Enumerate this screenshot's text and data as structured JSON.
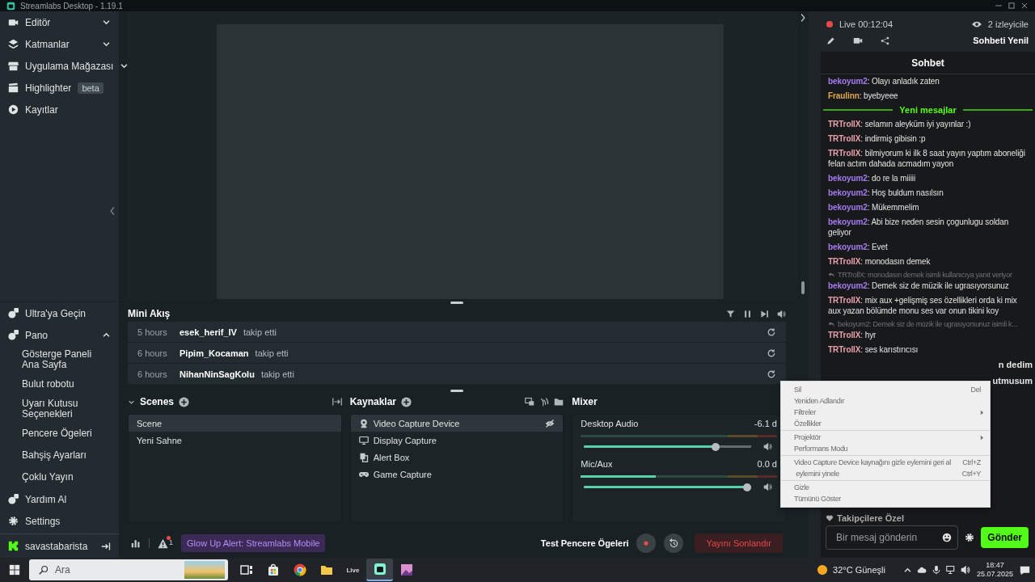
{
  "window": {
    "title": "Streamlabs Desktop - 1.19.1"
  },
  "sidebar": {
    "items": [
      {
        "label": "Editör",
        "expanded": false
      },
      {
        "label": "Katmanlar",
        "expanded": false
      },
      {
        "label": "Uygulama Mağazası",
        "expanded": false
      },
      {
        "label": "Highlighter",
        "badge": "beta"
      },
      {
        "label": "Kayıtlar"
      }
    ],
    "bottom_items": [
      {
        "label": "Ultra'ya Geçin"
      },
      {
        "label": "Pano",
        "expanded": true,
        "children": [
          {
            "label": "Gösterge Paneli Ana Sayfa"
          },
          {
            "label": "Bulut robotu"
          },
          {
            "label": "Uyarı Kutusu Seçenekleri"
          },
          {
            "label": "Pencere Ögeleri"
          },
          {
            "label": "Bahşiş Ayarları"
          },
          {
            "label": "Çoklu Yayın"
          }
        ]
      },
      {
        "label": "Yardım Al"
      },
      {
        "label": "Settings"
      }
    ],
    "user": {
      "name": "savastabarista"
    }
  },
  "mini_feed": {
    "title": "Mini Akış",
    "events": [
      {
        "time": "5 hours",
        "user": "esek_herif_IV",
        "action": "takip etti"
      },
      {
        "time": "6 hours",
        "user": "Pipim_Kocaman",
        "action": "takip etti"
      },
      {
        "time": "6 hours",
        "user": "NihanNinSagKolu",
        "action": "takip etti"
      }
    ]
  },
  "scenes": {
    "title": "Scenes",
    "items": [
      {
        "label": "Scene",
        "selected": true
      },
      {
        "label": "Yeni Sahne",
        "selected": false
      }
    ]
  },
  "sources": {
    "title": "Kaynaklar",
    "items": [
      {
        "label": "Video Capture Device",
        "kind": "webcam",
        "selected": true,
        "hidden": true
      },
      {
        "label": "Display Capture",
        "kind": "display",
        "selected": false,
        "hidden": false
      },
      {
        "label": "Alert Box",
        "kind": "alert",
        "selected": false,
        "hidden": false
      },
      {
        "label": "Game Capture",
        "kind": "game",
        "selected": false,
        "hidden": false
      }
    ]
  },
  "mixer": {
    "title": "Mixer",
    "channels": [
      {
        "name": "Desktop Audio",
        "reading": "-6.1 d",
        "level": 0.8
      },
      {
        "name": "Mic/Aux",
        "reading": "0.0 d",
        "level": 1.0,
        "meter": {
          "level": 0.38
        }
      }
    ]
  },
  "bottom_bar": {
    "alert_count": "1",
    "notification": "Glow Up Alert: Streamlabs Mobile",
    "test_label": "Test Pencere Ögeleri",
    "end_stream": "Yayını Sonlandır"
  },
  "chat": {
    "status": "Live 00:12:04",
    "viewers": "2 izleyicile",
    "refresh": "Sohbeti Yenil",
    "title": "Sohbet",
    "messages": [
      {
        "kind": "message",
        "user": "bekoyum2",
        "color": "#a47cf0",
        "text": ": Olayı anladık zaten"
      },
      {
        "kind": "message",
        "user": "Fraulinn",
        "color": "#e0a84e",
        "text": ": byebyeee"
      },
      {
        "kind": "divider",
        "text": "Yeni mesajlar"
      },
      {
        "kind": "message",
        "user": "TRTrollX",
        "color": "#e8a0ab",
        "text": ": selamın aleyküm iyi yayınlar :)"
      },
      {
        "kind": "message",
        "user": "TRTrollX",
        "color": "#e8a0ab",
        "text": ": indirmiş gibisin :p"
      },
      {
        "kind": "message",
        "user": "TRTrollX",
        "color": "#e8a0ab",
        "text": ": bilmiyorum ki ilk 8 saat yayın yaptım aboneliği felan actım dahada acmadım yayon"
      },
      {
        "kind": "message",
        "user": "bekoyum2",
        "color": "#a47cf0",
        "text": ": do re la miiiii"
      },
      {
        "kind": "message",
        "user": "bekoyum2",
        "color": "#a47cf0",
        "text": ": Hoş buldum nasılsın"
      },
      {
        "kind": "message",
        "user": "bekoyum2",
        "color": "#a47cf0",
        "text": ": Mükemmelim"
      },
      {
        "kind": "message",
        "user": "bekoyum2",
        "color": "#a47cf0",
        "text": ": Abi bize neden sesin çogunlugu soldan geliyor"
      },
      {
        "kind": "message",
        "user": "bekoyum2",
        "color": "#a47cf0",
        "text": ": Evet"
      },
      {
        "kind": "message",
        "user": "TRTrollX",
        "color": "#e8a0ab",
        "text": ": monodasın demek"
      },
      {
        "kind": "reply",
        "text": "TRTrollX: monodasın demek isimli kullanıcıya yanıt veriyor"
      },
      {
        "kind": "message",
        "user": "bekoyum2",
        "color": "#a47cf0",
        "text": ": Demek siz de müzik ile ugrasıyorsunuz"
      },
      {
        "kind": "message",
        "user": "TRTrollX",
        "color": "#e8a0ab",
        "text": ": mix aux +gelişmiş ses özellikleri orda ki mix aux yazan bölümde monu ses var onun tikini koy"
      },
      {
        "kind": "reply",
        "text": "bekoyum2: Demek siz de müzik ile ugrasıyorsunuz isimli k..."
      },
      {
        "kind": "message",
        "user": "TRTrollX",
        "color": "#e8a0ab",
        "text": ": hyr"
      },
      {
        "kind": "message",
        "user": "TRTrollX",
        "color": "#e8a0ab",
        "text": ": ses karıstırıcısı"
      },
      {
        "kind": "fragment",
        "text": "n dedim"
      },
      {
        "kind": "fragment",
        "text": "utmusum"
      }
    ],
    "follower_only": "Takipçilere Özel",
    "input": {
      "placeholder": "Bir mesaj gönderin"
    },
    "send": "Gönder"
  },
  "context_menu": {
    "groups": [
      [
        {
          "label": "Sil",
          "shortcut": "Del"
        },
        {
          "label": "Yeniden Adlandır"
        },
        {
          "label": "Filtreler",
          "submenu": true
        },
        {
          "label": "Özellikler"
        }
      ],
      [
        {
          "label": "Projektör",
          "submenu": true
        },
        {
          "label": "Performans Modu"
        }
      ],
      [
        {
          "label": "Video Capture Device kaynağını gizle eylemini geri al",
          "shortcut": "Ctrl+Z"
        },
        {
          "label": " eylemini yinele",
          "shortcut": "Ctrl+Y"
        }
      ],
      [
        {
          "label": "Gizle"
        },
        {
          "label": "Tümünü Göster"
        }
      ]
    ]
  },
  "taskbar": {
    "search": {
      "placeholder": "Ara"
    },
    "apps": [
      {
        "active": false
      },
      {
        "active": false
      },
      {
        "active": false
      },
      {
        "active": false
      },
      {
        "active": false,
        "label": "Live"
      },
      {
        "active": true
      },
      {
        "active": false
      }
    ],
    "weather": "32°C Güneşli",
    "time": "18:47",
    "date": "25.07.2025"
  }
}
